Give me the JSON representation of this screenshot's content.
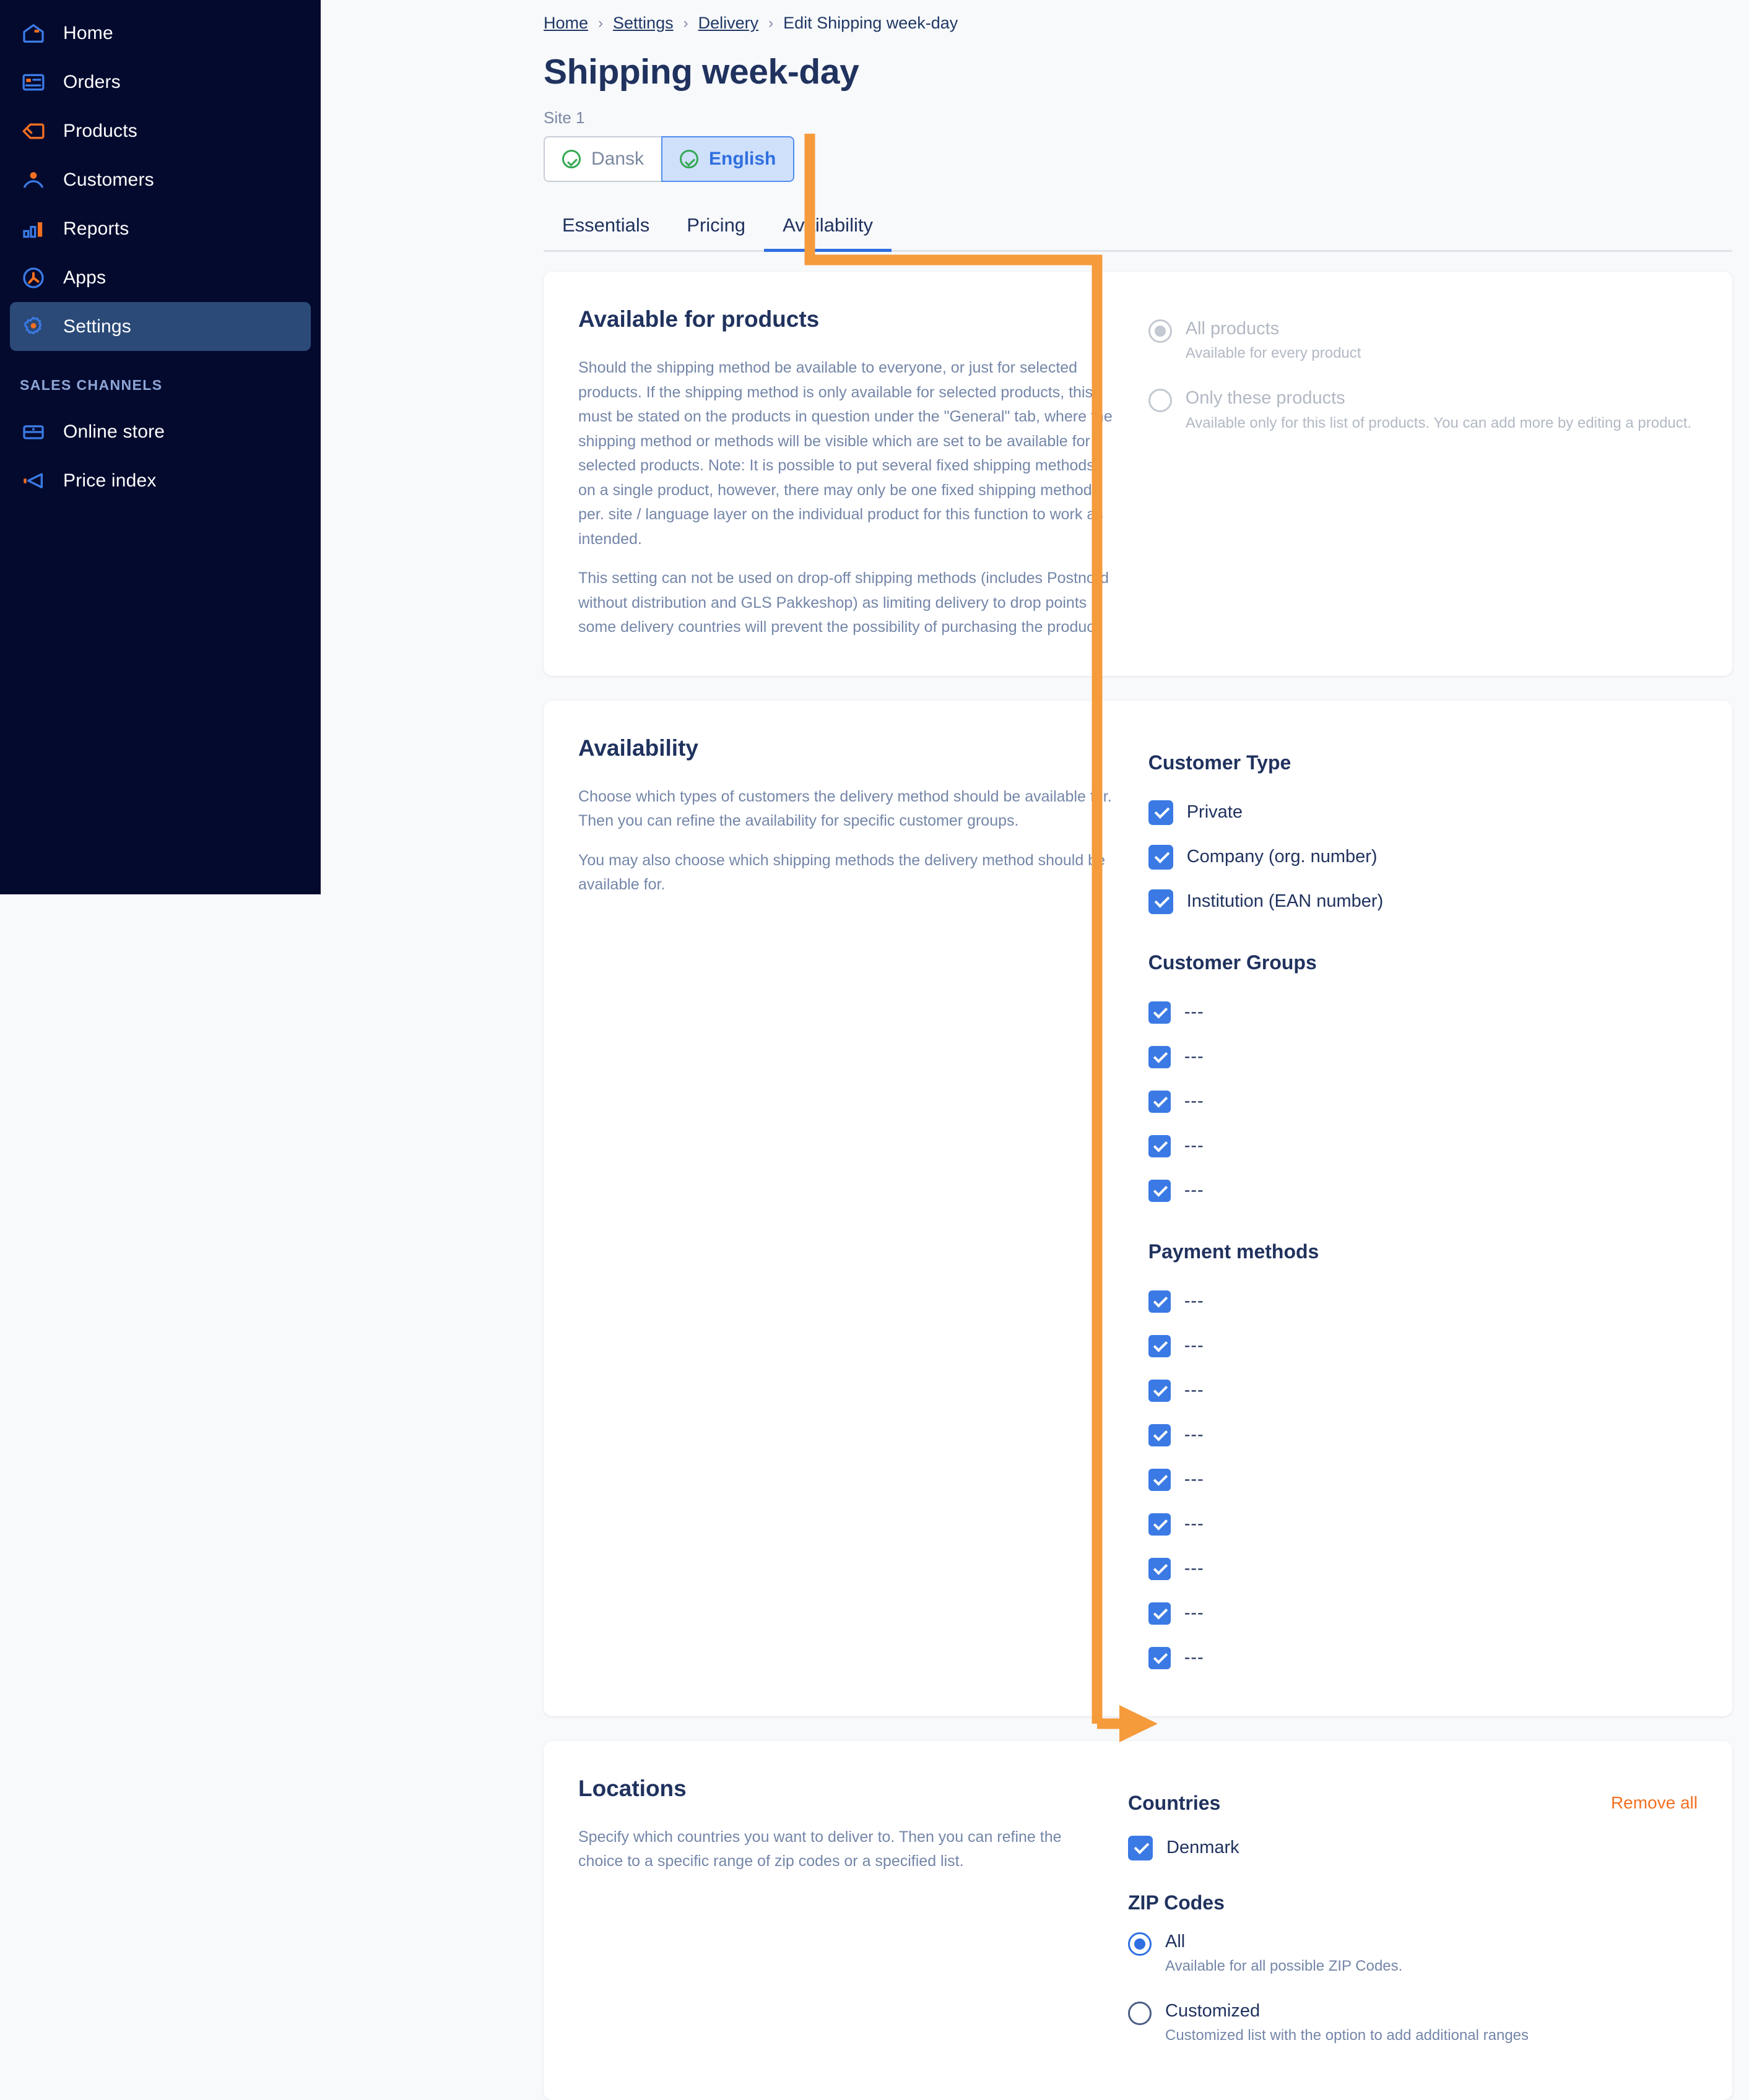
{
  "sidebar": {
    "items": [
      {
        "label": "Home",
        "icon": "home-icon"
      },
      {
        "label": "Orders",
        "icon": "orders-icon"
      },
      {
        "label": "Products",
        "icon": "tag-icon"
      },
      {
        "label": "Customers",
        "icon": "person-icon"
      },
      {
        "label": "Reports",
        "icon": "bar-chart-icon"
      },
      {
        "label": "Apps",
        "icon": "apps-icon"
      },
      {
        "label": "Settings",
        "icon": "gear-icon"
      }
    ],
    "section_title": "SALES CHANNELS",
    "channels": [
      {
        "label": "Online store",
        "icon": "store-icon"
      },
      {
        "label": "Price index",
        "icon": "megaphone-icon"
      }
    ]
  },
  "breadcrumb": {
    "home": "Home",
    "settings": "Settings",
    "delivery": "Delivery",
    "current": "Edit Shipping week-day",
    "separator": "›"
  },
  "header": {
    "title": "Shipping week-day",
    "site_label": "Site 1",
    "languages": [
      {
        "label": "Dansk",
        "selected": false
      },
      {
        "label": "English",
        "selected": true
      }
    ]
  },
  "tabs": [
    {
      "label": "Essentials",
      "active": false
    },
    {
      "label": "Pricing",
      "active": false
    },
    {
      "label": "Availability",
      "active": true
    }
  ],
  "available_for_products": {
    "title": "Available for products",
    "paragraphs": [
      "Should the shipping method be available to everyone, or just for selected products. If the shipping method is only available for selected products, this must be stated on the products in question under the \"General\" tab, where the shipping method or methods will be visible which are set to be available for selected products. Note: It is possible to put several fixed shipping methods on a single product, however, there may only be one fixed shipping method per. site / language layer on the individual product for this function to work as intended.",
      "This setting can not be used on drop-off shipping methods (includes Postnord without distribution and GLS Pakkeshop) as limiting delivery to drop points in some delivery countries will prevent the possibility of purchasing the product."
    ],
    "options": [
      {
        "label": "All products",
        "desc": "Available for every product",
        "checked": true
      },
      {
        "label": "Only these products",
        "desc": "Available only for this list of products. You can add more by editing a product.",
        "checked": false
      }
    ]
  },
  "availability": {
    "title": "Availability",
    "paragraphs": [
      "Choose which types of customers the delivery method should be available for. Then you can refine the availability for specific customer groups.",
      "You may also choose which shipping methods the delivery method should be available for."
    ],
    "customer_type": {
      "title": "Customer Type",
      "items": [
        {
          "label": "Private",
          "checked": true
        },
        {
          "label": "Company (org. number)",
          "checked": true
        },
        {
          "label": "Institution (EAN number)",
          "checked": true
        }
      ]
    },
    "customer_groups": {
      "title": "Customer Groups",
      "items": [
        {
          "label": "---",
          "checked": true
        },
        {
          "label": "---",
          "checked": true
        },
        {
          "label": "---",
          "checked": true
        },
        {
          "label": "---",
          "checked": true
        },
        {
          "label": "---",
          "checked": true
        }
      ]
    },
    "payment_methods": {
      "title": "Payment methods",
      "items": [
        {
          "label": "---",
          "checked": true
        },
        {
          "label": "---",
          "checked": true
        },
        {
          "label": "---",
          "checked": true
        },
        {
          "label": "---",
          "checked": true
        },
        {
          "label": "---",
          "checked": true
        },
        {
          "label": "---",
          "checked": true
        },
        {
          "label": "---",
          "checked": true
        },
        {
          "label": "---",
          "checked": true
        },
        {
          "label": "---",
          "checked": true
        }
      ]
    }
  },
  "locations": {
    "title": "Locations",
    "paragraphs": [
      "Specify which countries you want to deliver to. Then you can refine the choice to a specific range of zip codes or a specified list."
    ],
    "countries_title": "Countries",
    "remove_all": "Remove all",
    "countries": [
      {
        "label": "Denmark",
        "checked": true
      }
    ],
    "zip_title": "ZIP Codes",
    "zip_options": [
      {
        "label": "All",
        "desc": "Available for all possible ZIP Codes.",
        "checked": true
      },
      {
        "label": "Customized",
        "desc": "Customized list with the option to add additional ranges",
        "checked": false
      }
    ]
  },
  "colors": {
    "sidebar_bg": "#040a2e",
    "sidebar_active": "#2b4a78",
    "accent_orange": "#f37021",
    "accent_blue": "#2f6fe0",
    "checkbox_blue": "#3b7ae4",
    "heading_navy": "#20325e",
    "page_bg": "#f8f9fb",
    "annotation": "#f59B3C"
  }
}
